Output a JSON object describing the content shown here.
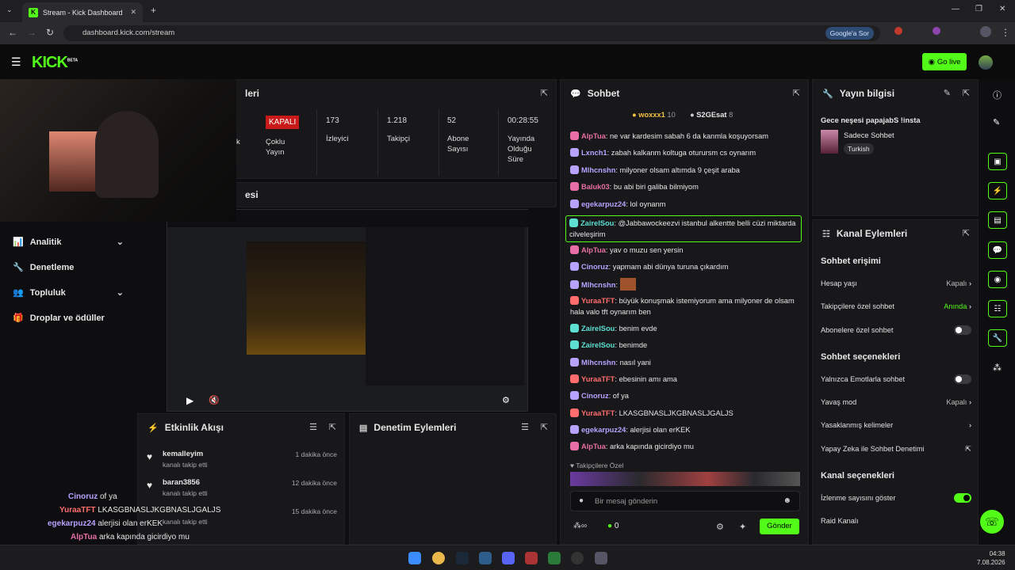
{
  "browser": {
    "tab_title": "Stream - Kick Dashboard",
    "url": "dashboard.kick.com/stream",
    "google_label": "Google'a Sor"
  },
  "topbar": {
    "logo": "KICK",
    "logo_sup": "BETA",
    "go_live": "Go live"
  },
  "sidebar": {
    "items": [
      {
        "label": "Analitik",
        "expandable": true
      },
      {
        "label": "Denetleme",
        "expandable": false
      },
      {
        "label": "Topluluk",
        "expandable": true
      },
      {
        "label": "Droplar ve ödüller",
        "expandable": false
      }
    ]
  },
  "stream_panel": {
    "title_fragment": "leri",
    "section_fragment": "esi",
    "stats": [
      {
        "value": "KAPALI",
        "label": "Çoklu Yayın"
      },
      {
        "value": "173",
        "label": "İzleyici"
      },
      {
        "value": "1.218",
        "label": "Takipçi"
      },
      {
        "value": "52",
        "label": "Abone Sayısı"
      },
      {
        "value": "00:28:55",
        "label": "Yayında Olduğu Süre"
      }
    ],
    "left_fragment": "k"
  },
  "chat": {
    "title": "Sohbet",
    "top_gifters": [
      {
        "name": "woxxx1",
        "count": "10"
      },
      {
        "name": "S2GEsat",
        "count": "8"
      }
    ],
    "messages": [
      {
        "user": "AlpTua",
        "text": "ne var kardesim sabah 6 da kanmla koşuyorsam",
        "color": "#e86fa6"
      },
      {
        "user": "Lxnch1",
        "text": "zabah kalkanm koltuga oturursm cs oynarım",
        "color": "#b7a3ff"
      },
      {
        "user": "Mlhcnshn",
        "text": "milyoner olsam altımda 9 çeşit araba",
        "color": "#b7a3ff"
      },
      {
        "user": "Baluk03",
        "text": "bu abi biri galiba bilmiyom",
        "color": "#e86fa6"
      },
      {
        "user": "egekarpuz24",
        "text": "lol oynanm",
        "color": "#b7a3ff"
      },
      {
        "user": "ZairelSou",
        "text": "@Jabbawockeezvi istanbul alkentte belli cüzi miktarda cilveleşirim",
        "color": "#5de0d2"
      },
      {
        "user": "AlpTua",
        "text": "yav o muzu sen yersin",
        "color": "#e86fa6"
      },
      {
        "user": "Cinoruz",
        "text": "yapmam abi dünya turuna çıkardım",
        "color": "#b7a3ff"
      },
      {
        "user": "Mlhcnshn",
        "text": "",
        "color": "#b7a3ff"
      },
      {
        "user": "YuraaTFT",
        "text": "büyük konuşmak istemiyorum ama milyoner de olsam hala valo tft oynarım ben",
        "color": "#ff6d6d"
      },
      {
        "user": "ZairelSou",
        "text": "benim evde",
        "color": "#5de0d2"
      },
      {
        "user": "ZairelSou",
        "text": "benimde",
        "color": "#5de0d2"
      },
      {
        "user": "Mlhcnshn",
        "text": "nasıl yani",
        "color": "#b7a3ff"
      },
      {
        "user": "YuraaTFT",
        "text": "ebesinin amı ama",
        "color": "#ff6d6d"
      },
      {
        "user": "Cinoruz",
        "text": "of ya",
        "color": "#b7a3ff"
      },
      {
        "user": "YuraaTFT",
        "text": "LKASGBNASLJKGBNASLJGALJS",
        "color": "#ff6d6d"
      },
      {
        "user": "egekarpuz24",
        "text": "alerjisi olan erKEK",
        "color": "#b7a3ff"
      },
      {
        "user": "AlpTua",
        "text": "arka kapında gicirdiyo mu",
        "color": "#e86fa6"
      }
    ],
    "followers_only": "Takipçilere Özel",
    "input_placeholder": "Bir mesaj gönderin",
    "points": "0",
    "send": "Gönder"
  },
  "stream_info": {
    "title": "Yayın bilgisi",
    "stream_title": "Gece neşesi papajabS !insta",
    "category": "Sadece Sohbet",
    "language": "Turkish"
  },
  "channel_actions": {
    "title": "Kanal Eylemleri",
    "chat_access": "Sohbet erişimi",
    "account_age": {
      "label": "Hesap yaşı",
      "value": "Kapalı"
    },
    "followers_chat": {
      "label": "Takipçilere özel sohbet",
      "value": "Anında"
    },
    "subs_chat": {
      "label": "Abonelere özel sohbet",
      "on": false
    },
    "chat_options": "Sohbet seçenekleri",
    "emote_only": {
      "label": "Yalnızca Emotlarla sohbet",
      "on": false
    },
    "slow_mode": {
      "label": "Yavaş mod",
      "value": "Kapalı"
    },
    "banned_words": "Yasaklanmış kelimeler",
    "ai_moderation": "Yapay Zeka ile Sohbet Denetimi",
    "channel_options": "Kanal seçenekleri",
    "show_viewers": {
      "label": "İzlenme sayısını göster",
      "on": true
    },
    "raid": "Raid Kanalı"
  },
  "activity": {
    "title": "Etkinlik Akışı",
    "items": [
      {
        "user": "kemalleyim",
        "text": "kanalı takip etti",
        "time": "1 dakika önce"
      },
      {
        "user": "baran3856",
        "text": "kanalı takip etti",
        "time": "12 dakika önce"
      },
      {
        "user": "",
        "text": "kanalı takip etti",
        "time": "15 dakika önce"
      }
    ]
  },
  "moderation": {
    "title": "Denetim Eylemleri"
  },
  "overlay": {
    "lines": [
      {
        "user": "Cinoruz",
        "text": "of ya",
        "color": "#b7a3ff"
      },
      {
        "user": "YuraaTFT",
        "text": "LKASGBNASLJKGBNASLJGALJS",
        "color": "#ff6d6d"
      },
      {
        "user": "egekarpuz24",
        "text": "alerjisi olan erKEK",
        "color": "#b7a3ff"
      },
      {
        "user": "AlpTua",
        "text": "arka kapında gicirdiyo mu",
        "color": "#e86fa6"
      }
    ]
  },
  "taskbar": {
    "time": "04:38",
    "date": "7.08.2026"
  },
  "colors": {
    "accent": "#53fc18",
    "panel": "#18181b",
    "bg": "#0e0e10"
  }
}
